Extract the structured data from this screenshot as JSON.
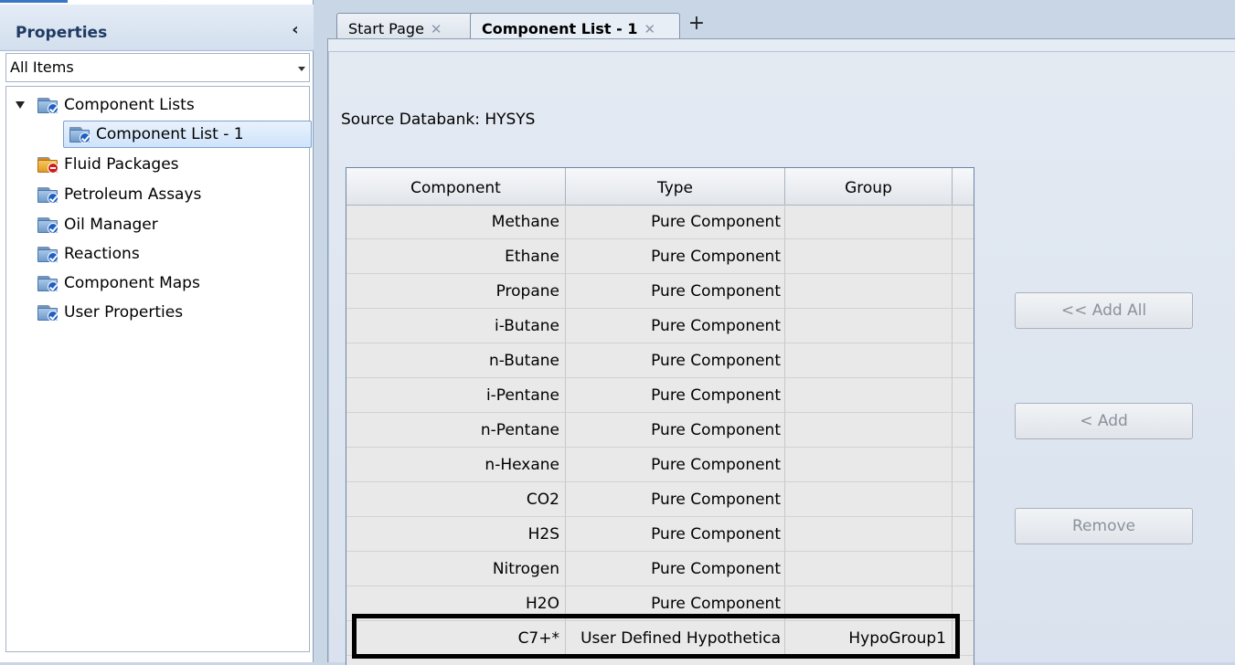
{
  "properties_pane": {
    "title": "Properties",
    "collapse_glyph": "‹",
    "filter": {
      "selected": "All Items"
    },
    "tree": [
      {
        "label": "Component Lists",
        "icon": "folder-check-icon",
        "expanded": true
      },
      {
        "label": "Component List - 1",
        "icon": "folder-check-icon",
        "selected": true
      },
      {
        "label": "Fluid Packages",
        "icon": "folder-error-icon"
      },
      {
        "label": "Petroleum Assays",
        "icon": "folder-check-icon"
      },
      {
        "label": "Oil Manager",
        "icon": "folder-check-icon"
      },
      {
        "label": "Reactions",
        "icon": "folder-check-icon"
      },
      {
        "label": "Component Maps",
        "icon": "folder-check-icon"
      },
      {
        "label": "User Properties",
        "icon": "folder-check-icon"
      }
    ]
  },
  "tabs": [
    {
      "label": "Start Page",
      "active": false,
      "close": "✕"
    },
    {
      "label": "Component List - 1",
      "active": true,
      "close": "✕"
    }
  ],
  "new_tab_glyph": "+",
  "main": {
    "source_databank": "Source Databank: HYSYS",
    "table": {
      "columns": [
        "Component",
        "Type",
        "Group"
      ],
      "rows": [
        {
          "component": "Methane",
          "type": "Pure Component",
          "group": ""
        },
        {
          "component": "Ethane",
          "type": "Pure Component",
          "group": ""
        },
        {
          "component": "Propane",
          "type": "Pure Component",
          "group": ""
        },
        {
          "component": "i-Butane",
          "type": "Pure Component",
          "group": ""
        },
        {
          "component": "n-Butane",
          "type": "Pure Component",
          "group": ""
        },
        {
          "component": "i-Pentane",
          "type": "Pure Component",
          "group": ""
        },
        {
          "component": "n-Pentane",
          "type": "Pure Component",
          "group": ""
        },
        {
          "component": "n-Hexane",
          "type": "Pure Component",
          "group": ""
        },
        {
          "component": "CO2",
          "type": "Pure Component",
          "group": ""
        },
        {
          "component": "H2S",
          "type": "Pure Component",
          "group": ""
        },
        {
          "component": "Nitrogen",
          "type": "Pure Component",
          "group": ""
        },
        {
          "component": "H2O",
          "type": "Pure Component",
          "group": ""
        },
        {
          "component": "C7+*",
          "type": "User Defined Hypothetica",
          "group": "HypoGroup1"
        }
      ]
    },
    "buttons": {
      "add_all": "<< Add All",
      "add": "< Add",
      "remove": "Remove"
    }
  }
}
